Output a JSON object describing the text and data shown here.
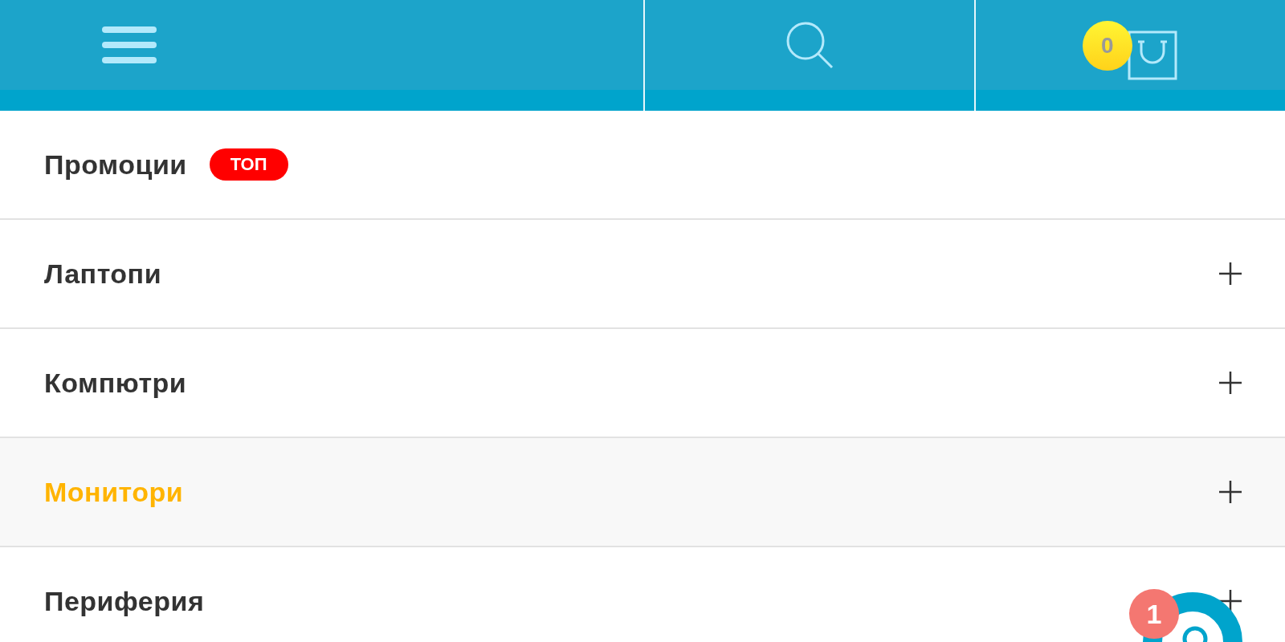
{
  "header": {
    "cart_count": "0"
  },
  "menu": [
    {
      "label": "Промоции",
      "kind": "link",
      "badge": "ТОП",
      "selected": false
    },
    {
      "label": "Лаптопи",
      "kind": "group",
      "expanded": false,
      "selected": false
    },
    {
      "label": "Компютри",
      "kind": "group",
      "expanded": false,
      "selected": false
    },
    {
      "label": "Монитори",
      "kind": "group",
      "expanded": false,
      "selected": true
    },
    {
      "label": "Периферия",
      "kind": "group",
      "expanded": false,
      "selected": false
    }
  ],
  "chat": {
    "unread": "1"
  }
}
